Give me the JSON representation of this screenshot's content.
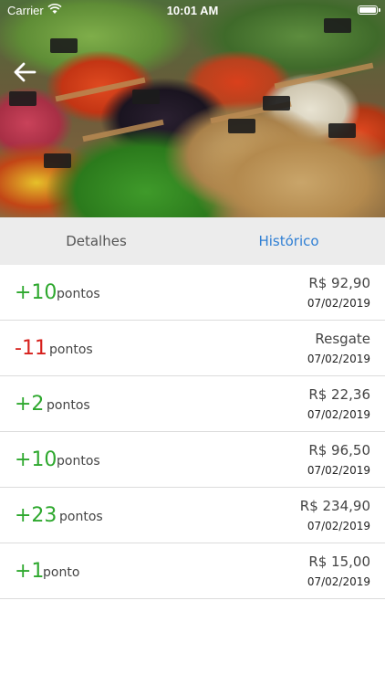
{
  "status_bar": {
    "carrier": "Carrier",
    "time": "10:01 AM"
  },
  "tabs": [
    {
      "label": "Detalhes",
      "active": false
    },
    {
      "label": "Histórico",
      "active": true
    }
  ],
  "colors": {
    "positive": "#2ea82e",
    "negative": "#d6201c",
    "active_tab": "#2f7fd4"
  },
  "history": [
    {
      "points": "+10",
      "unit": "pontos",
      "amount": "R$ 92,90",
      "date": "07/02/2019"
    },
    {
      "points": "-11",
      "unit": "pontos",
      "amount": "Resgate",
      "date": "07/02/2019"
    },
    {
      "points": "+2",
      "unit": "pontos",
      "amount": "R$ 22,36",
      "date": "07/02/2019"
    },
    {
      "points": "+10",
      "unit": "pontos",
      "amount": "R$ 96,50",
      "date": "07/02/2019"
    },
    {
      "points": "+23",
      "unit": "pontos",
      "amount": "R$ 234,90",
      "date": "07/02/2019"
    },
    {
      "points": "+1",
      "unit": "ponto",
      "amount": "R$ 15,00",
      "date": "07/02/2019"
    }
  ]
}
